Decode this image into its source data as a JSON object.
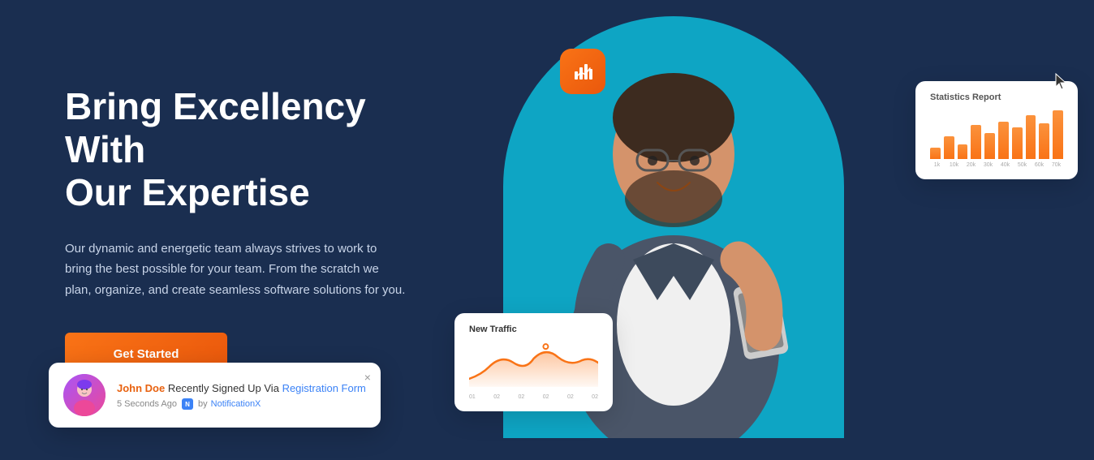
{
  "hero": {
    "heading_line1": "Bring Excellency With",
    "heading_line2": "Our Expertise",
    "description": "Our dynamic and energetic team always strives to work to bring the best possible for your team. From the scratch we plan, organize, and create seamless software solutions for you.",
    "cta_label": "Get Started"
  },
  "notification": {
    "name": "John Doe",
    "action_text": "Recently Signed Up Via",
    "link_text": "Registration Form",
    "time": "5 Seconds Ago",
    "by_text": "by",
    "brand": "NotificationX",
    "close_label": "×"
  },
  "stats_card": {
    "title": "Statistics Report",
    "bars": [
      15,
      30,
      20,
      45,
      35,
      50,
      42,
      58,
      48,
      65
    ],
    "labels": [
      "1k",
      "10k",
      "20k",
      "30k",
      "40k",
      "50k",
      "60k",
      "70k"
    ]
  },
  "traffic_card": {
    "title": "New Traffic",
    "x_labels": [
      "01",
      "02",
      "02",
      "02",
      "02",
      "02"
    ]
  },
  "icon_badge": {
    "aria": "chart-bar-icon"
  },
  "cursor": {
    "aria": "mouse-cursor"
  }
}
